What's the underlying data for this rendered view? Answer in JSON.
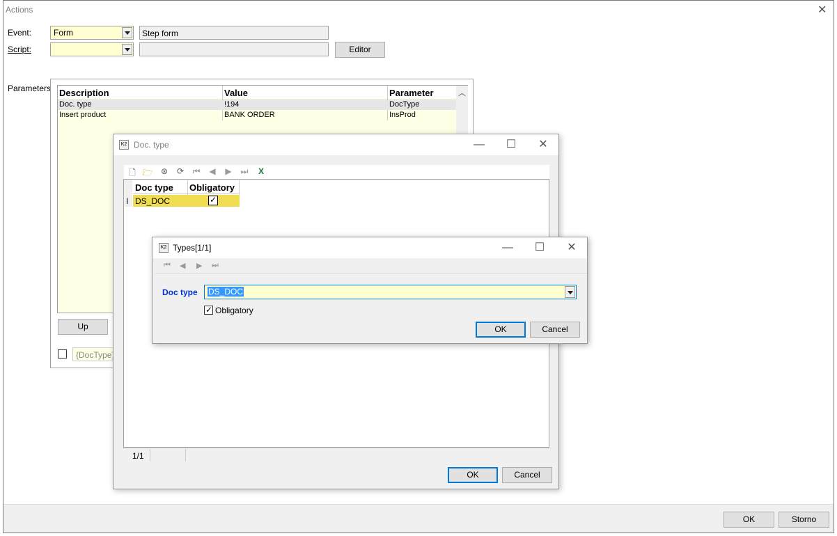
{
  "main_window": {
    "title": "Actions",
    "event_label": "Event:",
    "event_value": "Form",
    "event_desc": "Step form",
    "script_label": "Script:",
    "editor_button": "Editor",
    "parameters_label": "Parameters:",
    "params_table": {
      "headers": [
        "Description",
        "Value",
        "Parameter"
      ],
      "rows": [
        {
          "description": "Doc. type",
          "value": "!194",
          "parameter": "DocType"
        },
        {
          "description": "Insert product",
          "value": "BANK ORDER",
          "parameter": "InsProd"
        }
      ]
    },
    "up_button": "Up",
    "doctype_token": "{DocType}",
    "ok_button": "OK",
    "storno_button": "Storno"
  },
  "doctype_window": {
    "title": "Doc. type",
    "grid_headers": [
      "Doc type",
      "Obligatory"
    ],
    "grid_rows": [
      {
        "doc_type": "DS_DOC",
        "obligatory": true
      }
    ],
    "record_counter": "1/1",
    "ok_button": "OK",
    "cancel_button": "Cancel"
  },
  "types_dialog": {
    "title": "Types[1/1]",
    "doc_type_label": "Doc type",
    "doc_type_value": "DS_DOC",
    "obligatory_label": "Obligatory",
    "obligatory_checked": true,
    "ok_button": "OK",
    "cancel_button": "Cancel"
  },
  "colors": {
    "yellow_field": "#ffffd2",
    "highlight_row": "#f0dc50",
    "accent_blue": "#0078d7",
    "label_blue": "#0033cc"
  }
}
